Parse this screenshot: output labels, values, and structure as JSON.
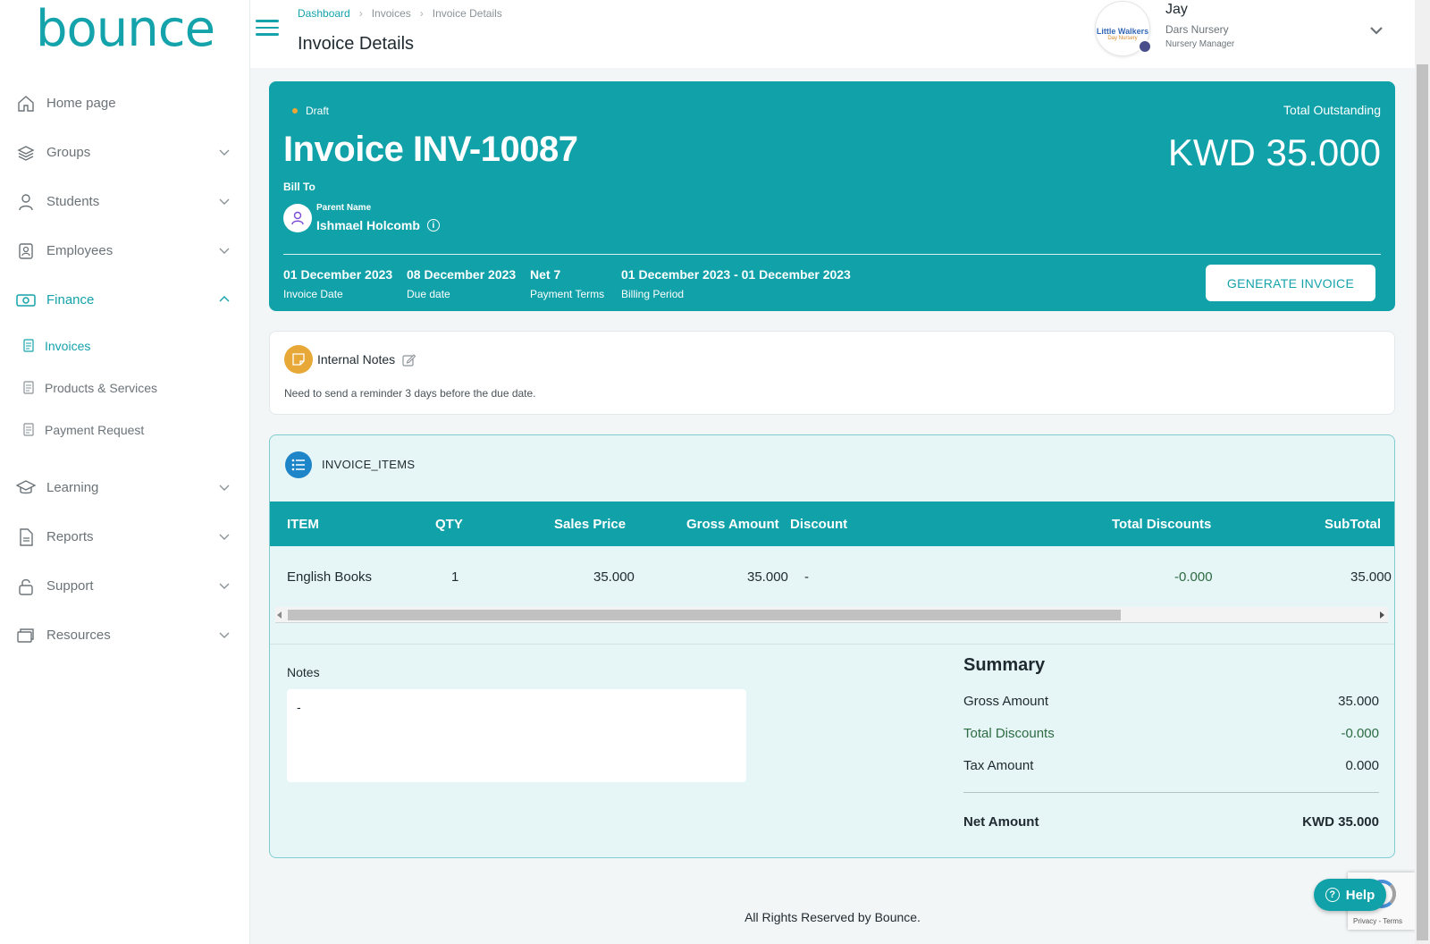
{
  "brand": {
    "logo_text": "bounce",
    "color": "#14a3ab"
  },
  "sidebar": {
    "items": [
      {
        "label": "Home page",
        "icon": "home-icon"
      },
      {
        "label": "Groups",
        "icon": "layers-icon"
      },
      {
        "label": "Students",
        "icon": "person-icon"
      },
      {
        "label": "Employees",
        "icon": "badge-icon"
      },
      {
        "label": "Finance",
        "icon": "money-icon"
      }
    ],
    "finance_sub": [
      {
        "label": "Invoices"
      },
      {
        "label": "Products & Services"
      },
      {
        "label": "Payment Request"
      }
    ],
    "items_after": [
      {
        "label": "Learning",
        "icon": "graduation-cap-icon"
      },
      {
        "label": "Reports",
        "icon": "report-icon"
      },
      {
        "label": "Support",
        "icon": "lock-icon"
      },
      {
        "label": "Resources",
        "icon": "folders-icon"
      }
    ]
  },
  "header": {
    "breadcrumb": [
      "Dashboard",
      "Invoices",
      "Invoice Details"
    ],
    "title": "Invoice Details",
    "user": {
      "name": "Jay",
      "org": "Dars Nursery",
      "role": "Nursery Manager",
      "org_logo_line1": "Little Walkers",
      "org_logo_line2": "Day Nursery"
    }
  },
  "invoice": {
    "status": "Draft",
    "title": "Invoice INV-10087",
    "total_label": "Total Outstanding",
    "total": "KWD 35.000",
    "bill_to": "Bill To",
    "parent_label": "Parent Name",
    "parent_name": "Ishmael Holcomb",
    "meta": [
      {
        "value": "01 December 2023",
        "label": "Invoice Date"
      },
      {
        "value": "08 December 2023",
        "label": "Due date"
      },
      {
        "value": "Net 7",
        "label": "Payment Terms"
      },
      {
        "value": "01 December 2023 - 01 December 2023",
        "label": "Billing Period"
      }
    ],
    "generate_button": "GENERATE INVOICE"
  },
  "internal_notes": {
    "title": "Internal Notes",
    "text": "Need to send a reminder 3 days before the due date."
  },
  "items": {
    "title": "INVOICE_ITEMS",
    "columns": [
      "ITEM",
      "QTY",
      "Sales Price",
      "Gross Amount",
      "Discount",
      "Total Discounts",
      "SubTotal"
    ],
    "rows": [
      {
        "item": "English Books",
        "qty": "1",
        "sales_price": "35.000",
        "gross": "35.000",
        "discount": "-",
        "total_discounts": "-0.000",
        "subtotal": "35.000"
      }
    ]
  },
  "notes": {
    "label": "Notes",
    "value": "-"
  },
  "summary": {
    "title": "Summary",
    "gross_label": "Gross Amount",
    "gross": "35.000",
    "discounts_label": "Total Discounts",
    "discounts": "-0.000",
    "tax_label": "Tax Amount",
    "tax": "0.000",
    "net_label": "Net Amount",
    "net": "KWD 35.000"
  },
  "footer": "All Rights Reserved by Bounce.",
  "help_label": "Help",
  "recaptcha_text": "Privacy - Terms",
  "colors": {
    "accent": "#10a1a9",
    "draft_dot": "#f0a534",
    "green": "#2d6b43"
  }
}
